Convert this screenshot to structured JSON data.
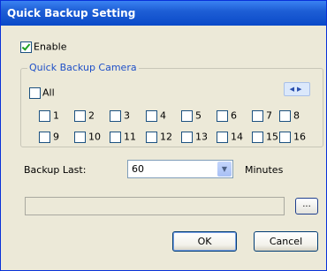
{
  "window": {
    "title": "Quick Backup Setting"
  },
  "enable": {
    "label": "Enable",
    "checked": true
  },
  "camera_group": {
    "title": "Quick Backup Camera",
    "all_label": "All",
    "all_checked": false,
    "nav_icon": "left-right-arrows-icon",
    "cameras": [
      {
        "label": "1",
        "checked": false
      },
      {
        "label": "2",
        "checked": false
      },
      {
        "label": "3",
        "checked": false
      },
      {
        "label": "4",
        "checked": false
      },
      {
        "label": "5",
        "checked": false
      },
      {
        "label": "6",
        "checked": false
      },
      {
        "label": "7",
        "checked": false
      },
      {
        "label": "8",
        "checked": false
      },
      {
        "label": "9",
        "checked": false
      },
      {
        "label": "10",
        "checked": false
      },
      {
        "label": "11",
        "checked": false
      },
      {
        "label": "12",
        "checked": false
      },
      {
        "label": "13",
        "checked": false
      },
      {
        "label": "14",
        "checked": false
      },
      {
        "label": "15",
        "checked": false
      },
      {
        "label": "16",
        "checked": false
      }
    ]
  },
  "backup_last": {
    "label": "Backup Last:",
    "value": "60",
    "unit": "Minutes"
  },
  "path": {
    "value": "",
    "browse_label": "..."
  },
  "buttons": {
    "ok": "OK",
    "cancel": "Cancel"
  },
  "colors": {
    "title_bar": "#0a49c8",
    "group_title": "#1f50c8",
    "check": "#21a121"
  }
}
